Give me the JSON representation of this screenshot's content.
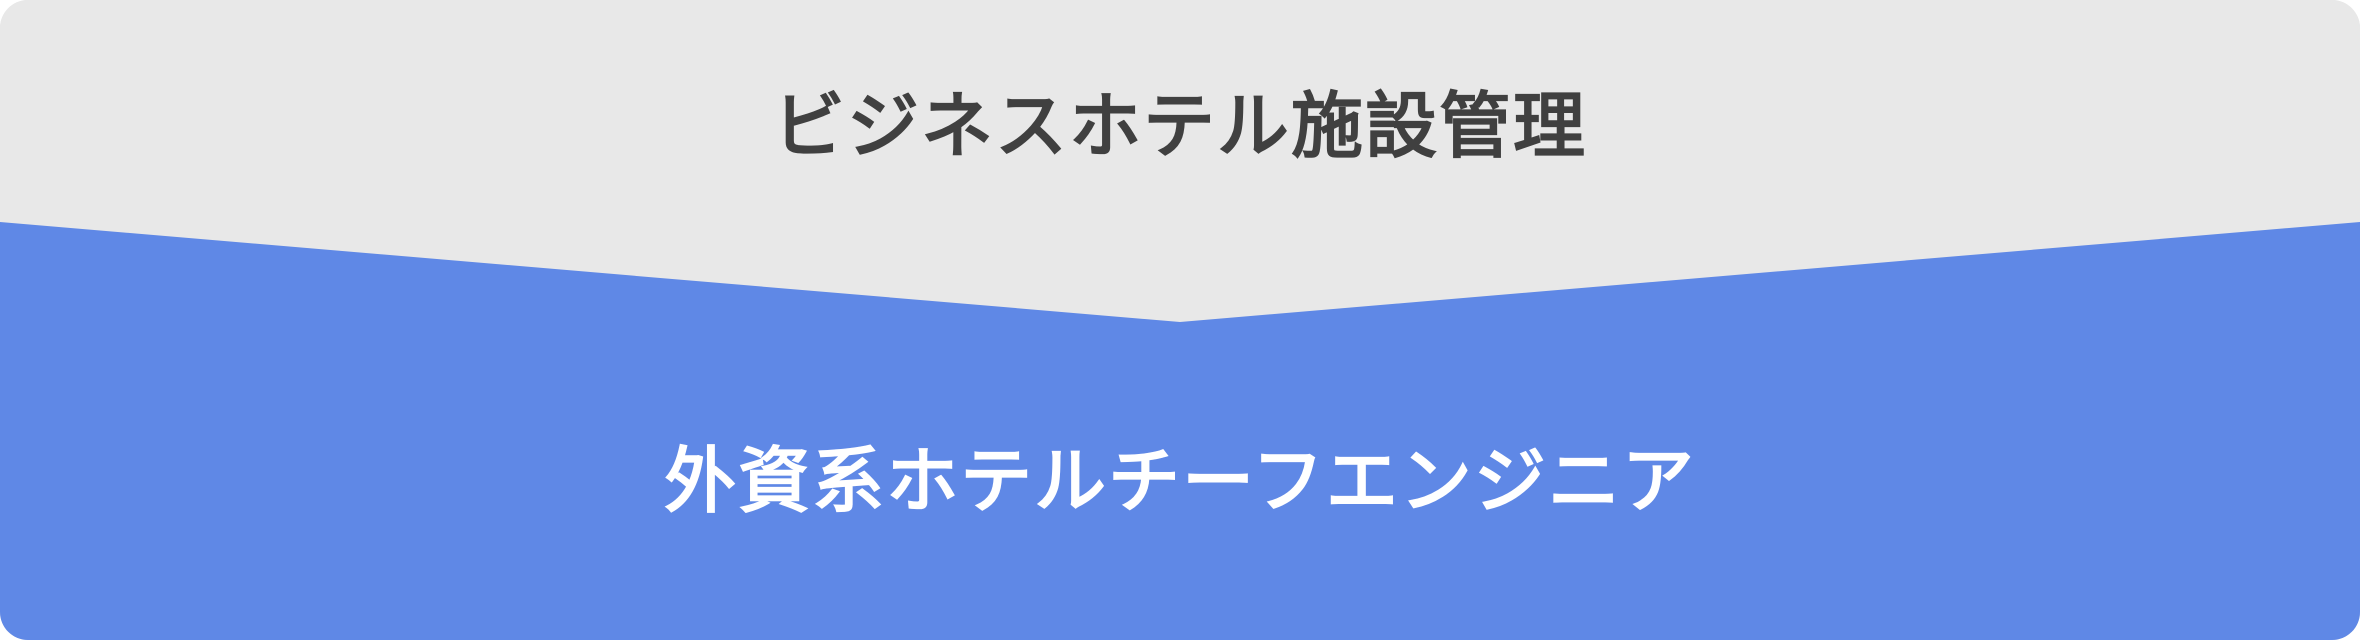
{
  "top_section": {
    "label": "ビジネスホテル施設管理",
    "background": "#e8e8e8",
    "text_color": "#404040"
  },
  "bottom_section": {
    "label": "外資系ホテルチーフエンジニア",
    "background": "#5f88e6",
    "text_color": "#ffffff"
  }
}
